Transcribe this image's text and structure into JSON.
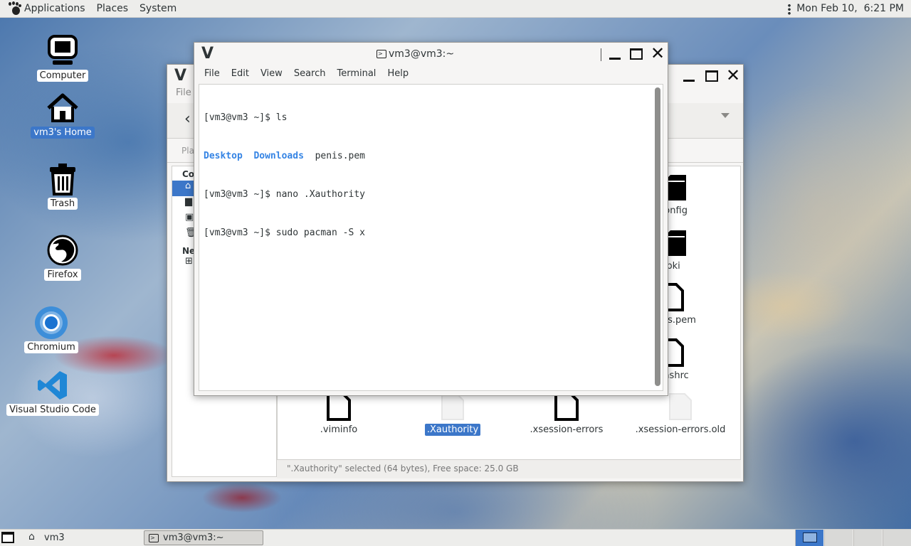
{
  "topbar": {
    "applications": "Applications",
    "places": "Places",
    "system": "System",
    "clock": "Mon Feb 10,  6:21 PM"
  },
  "desktop": {
    "icons": [
      {
        "label": "Computer",
        "icon": "computer-icon"
      },
      {
        "label": "vm3's Home",
        "icon": "home-icon"
      },
      {
        "label": "Trash",
        "icon": "trash-icon"
      },
      {
        "label": "Firefox",
        "icon": "firefox-icon"
      },
      {
        "label": "Chromium",
        "icon": "chromium-icon"
      },
      {
        "label": "Visual Studio Code",
        "icon": "vscode-icon"
      }
    ]
  },
  "filemanager": {
    "menu_file": "File",
    "sidebar_places": "Pla",
    "sidebar_computer": "Co",
    "sidebar_network": "Ne",
    "items": [
      ".config",
      ".pki",
      "penis.pem",
      ".bashrc",
      ".viminfo",
      ".Xauthority",
      ".xsession-errors",
      ".xsession-errors.old"
    ],
    "status": "\".Xauthority\" selected (64 bytes), Free space: 25.0 GB"
  },
  "terminal": {
    "title": "vm3@vm3:~",
    "menu": [
      "File",
      "Edit",
      "View",
      "Search",
      "Terminal",
      "Help"
    ],
    "lines": {
      "l1": "[vm3@vm3 ~]$ ls",
      "dir1": "Desktop",
      "dir2": "Downloads",
      "file1": "penis.pem",
      "l3": "[vm3@vm3 ~]$ nano .Xauthority",
      "l4": "[vm3@vm3 ~]$ sudo pacman -S x"
    }
  },
  "taskbar": {
    "location": "vm3",
    "task": "vm3@vm3:~"
  }
}
